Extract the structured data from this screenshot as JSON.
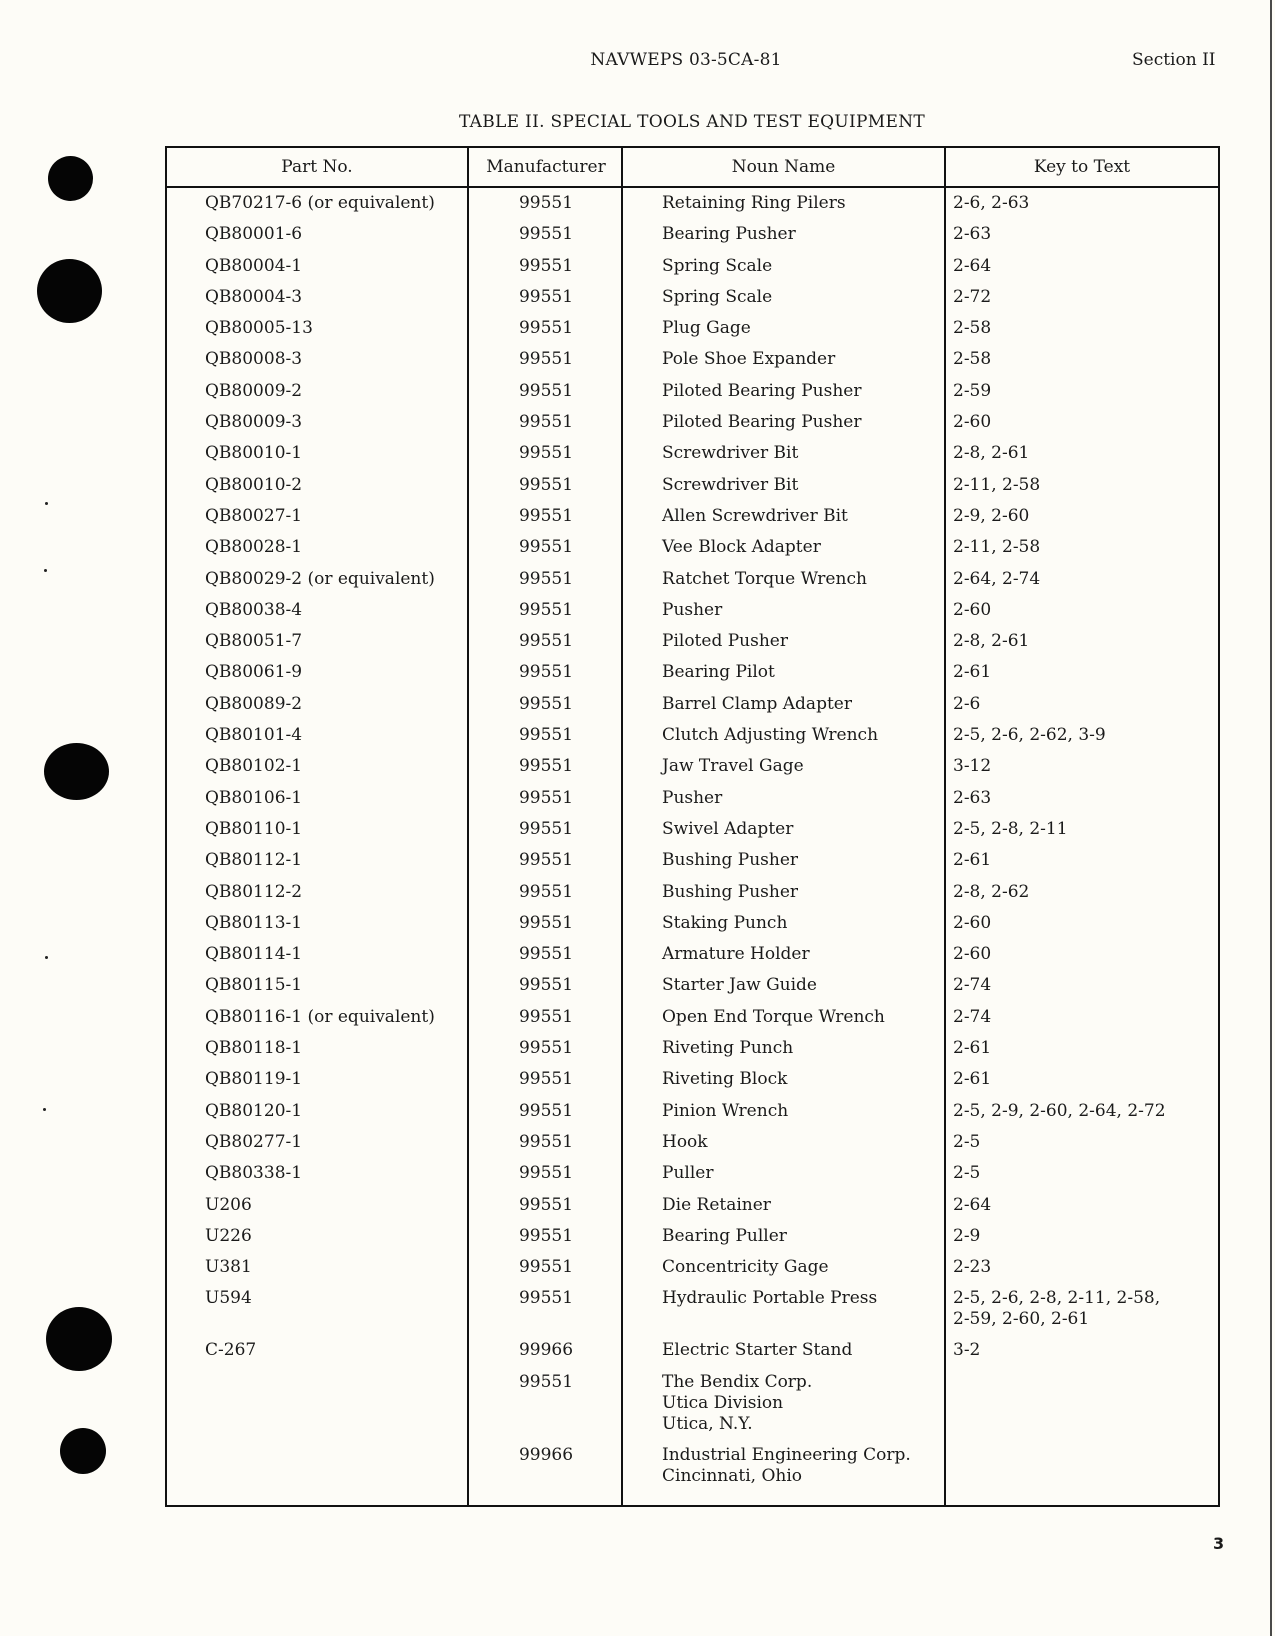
{
  "header": {
    "doc_id": "NAVWEPS 03-5CA-81",
    "section": "Section II"
  },
  "table": {
    "title": "TABLE II.  SPECIAL TOOLS AND TEST EQUIPMENT",
    "columns": [
      "Part No.",
      "Manufacturer",
      "Noun Name",
      "Key to Text"
    ],
    "rows": [
      {
        "part": "QB70217-6 (or equivalent)",
        "mfr": "99551",
        "noun": [
          "Retaining Ring Pilers"
        ],
        "key": [
          "2-6, 2-63"
        ]
      },
      {
        "part": "QB80001-6",
        "mfr": "99551",
        "noun": [
          "Bearing Pusher"
        ],
        "key": [
          "2-63"
        ]
      },
      {
        "part": "QB80004-1",
        "mfr": "99551",
        "noun": [
          "Spring Scale"
        ],
        "key": [
          "2-64"
        ]
      },
      {
        "part": "QB80004-3",
        "mfr": "99551",
        "noun": [
          "Spring Scale"
        ],
        "key": [
          "2-72"
        ]
      },
      {
        "part": "QB80005-13",
        "mfr": "99551",
        "noun": [
          "Plug Gage"
        ],
        "key": [
          "2-58"
        ]
      },
      {
        "part": "QB80008-3",
        "mfr": "99551",
        "noun": [
          "Pole Shoe Expander"
        ],
        "key": [
          "2-58"
        ]
      },
      {
        "part": "QB80009-2",
        "mfr": "99551",
        "noun": [
          "Piloted Bearing Pusher"
        ],
        "key": [
          "2-59"
        ]
      },
      {
        "part": "QB80009-3",
        "mfr": "99551",
        "noun": [
          "Piloted Bearing Pusher"
        ],
        "key": [
          "2-60"
        ]
      },
      {
        "part": "QB80010-1",
        "mfr": "99551",
        "noun": [
          "Screwdriver Bit"
        ],
        "key": [
          "2-8, 2-61"
        ]
      },
      {
        "part": "QB80010-2",
        "mfr": "99551",
        "noun": [
          "Screwdriver Bit"
        ],
        "key": [
          "2-11, 2-58"
        ]
      },
      {
        "part": "QB80027-1",
        "mfr": "99551",
        "noun": [
          "Allen Screwdriver Bit"
        ],
        "key": [
          "2-9, 2-60"
        ]
      },
      {
        "part": "QB80028-1",
        "mfr": "99551",
        "noun": [
          "Vee Block Adapter"
        ],
        "key": [
          "2-11, 2-58"
        ]
      },
      {
        "part": "QB80029-2 (or equivalent)",
        "mfr": "99551",
        "noun": [
          "Ratchet Torque Wrench"
        ],
        "key": [
          "2-64, 2-74"
        ]
      },
      {
        "part": "QB80038-4",
        "mfr": "99551",
        "noun": [
          "Pusher"
        ],
        "key": [
          "2-60"
        ]
      },
      {
        "part": "QB80051-7",
        "mfr": "99551",
        "noun": [
          "Piloted Pusher"
        ],
        "key": [
          "2-8, 2-61"
        ]
      },
      {
        "part": "QB80061-9",
        "mfr": "99551",
        "noun": [
          "Bearing Pilot"
        ],
        "key": [
          "2-61"
        ]
      },
      {
        "part": "QB80089-2",
        "mfr": "99551",
        "noun": [
          "Barrel Clamp Adapter"
        ],
        "key": [
          "2-6"
        ]
      },
      {
        "part": "QB80101-4",
        "mfr": "99551",
        "noun": [
          "Clutch Adjusting Wrench"
        ],
        "key": [
          "2-5, 2-6, 2-62, 3-9"
        ]
      },
      {
        "part": "QB80102-1",
        "mfr": "99551",
        "noun": [
          "Jaw Travel Gage"
        ],
        "key": [
          "3-12"
        ]
      },
      {
        "part": "QB80106-1",
        "mfr": "99551",
        "noun": [
          "Pusher"
        ],
        "key": [
          "2-63"
        ]
      },
      {
        "part": "QB80110-1",
        "mfr": "99551",
        "noun": [
          "Swivel Adapter"
        ],
        "key": [
          "2-5, 2-8, 2-11"
        ]
      },
      {
        "part": "QB80112-1",
        "mfr": "99551",
        "noun": [
          "Bushing Pusher"
        ],
        "key": [
          "2-61"
        ]
      },
      {
        "part": "QB80112-2",
        "mfr": "99551",
        "noun": [
          "Bushing Pusher"
        ],
        "key": [
          "2-8, 2-62"
        ]
      },
      {
        "part": "QB80113-1",
        "mfr": "99551",
        "noun": [
          "Staking Punch"
        ],
        "key": [
          "2-60"
        ]
      },
      {
        "part": "QB80114-1",
        "mfr": "99551",
        "noun": [
          "Armature Holder"
        ],
        "key": [
          "2-60"
        ]
      },
      {
        "part": "QB80115-1",
        "mfr": "99551",
        "noun": [
          "Starter Jaw Guide"
        ],
        "key": [
          "2-74"
        ]
      },
      {
        "part": "QB80116-1 (or equivalent)",
        "mfr": "99551",
        "noun": [
          "Open End Torque Wrench"
        ],
        "key": [
          "2-74"
        ]
      },
      {
        "part": "QB80118-1",
        "mfr": "99551",
        "noun": [
          "Riveting Punch"
        ],
        "key": [
          "2-61"
        ]
      },
      {
        "part": "QB80119-1",
        "mfr": "99551",
        "noun": [
          "Riveting Block"
        ],
        "key": [
          "2-61"
        ]
      },
      {
        "part": "QB80120-1",
        "mfr": "99551",
        "noun": [
          "Pinion Wrench"
        ],
        "key": [
          "2-5, 2-9, 2-60, 2-64, 2-72"
        ]
      },
      {
        "part": "QB80277-1",
        "mfr": "99551",
        "noun": [
          "Hook"
        ],
        "key": [
          "2-5"
        ]
      },
      {
        "part": "QB80338-1",
        "mfr": "99551",
        "noun": [
          "Puller"
        ],
        "key": [
          "2-5"
        ]
      },
      {
        "part": "U206",
        "mfr": "99551",
        "noun": [
          "Die Retainer"
        ],
        "key": [
          "2-64"
        ]
      },
      {
        "part": "U226",
        "mfr": "99551",
        "noun": [
          "Bearing Puller"
        ],
        "key": [
          "2-9"
        ]
      },
      {
        "part": "U381",
        "mfr": "99551",
        "noun": [
          "Concentricity Gage"
        ],
        "key": [
          "2-23"
        ]
      },
      {
        "part": "U594",
        "mfr": "99551",
        "noun": [
          "Hydraulic Portable Press"
        ],
        "key": [
          "2-5, 2-6, 2-8, 2-11, 2-58,",
          "2-59, 2-60, 2-61"
        ]
      },
      {
        "part": "C-267",
        "mfr": "99966",
        "noun": [
          "Electric Starter Stand"
        ],
        "key": [
          "3-2"
        ]
      },
      {
        "part": "",
        "mfr": "99551",
        "noun": [
          "The Bendix Corp.",
          "Utica Division",
          "Utica, N.Y."
        ],
        "key": []
      },
      {
        "part": "",
        "mfr": "99966",
        "noun": [
          "Industrial Engineering Corp.",
          "Cincinnati, Ohio"
        ],
        "key": []
      }
    ]
  },
  "footer": {
    "page_number": "3"
  }
}
